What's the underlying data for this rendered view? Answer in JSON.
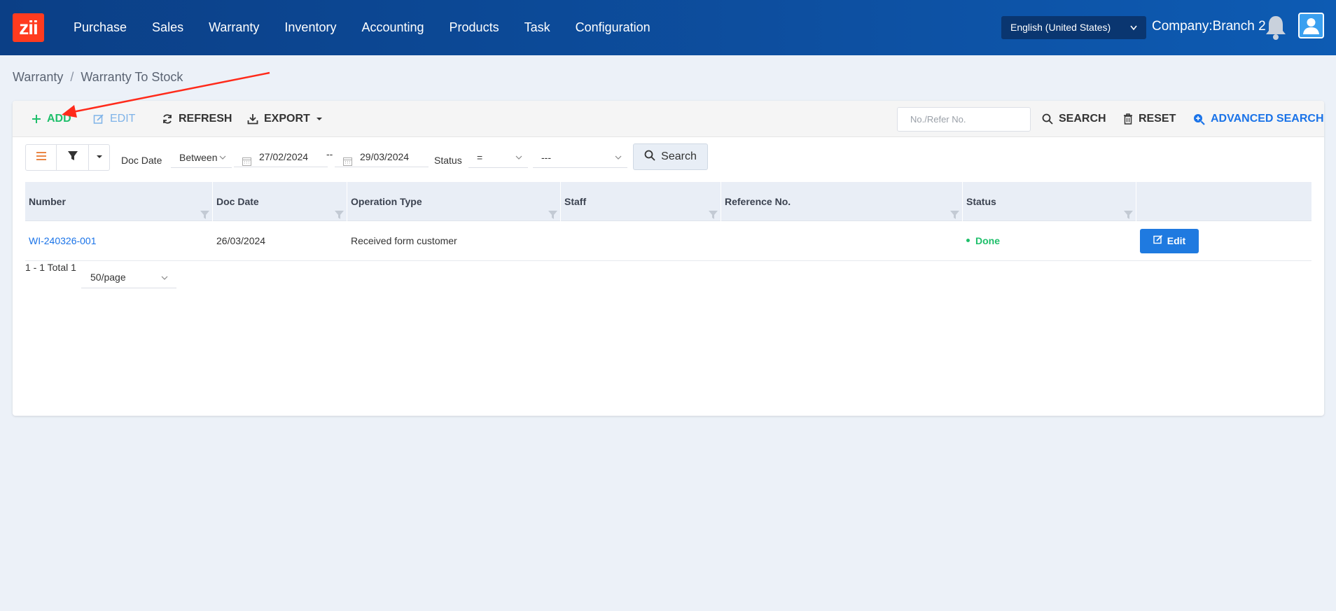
{
  "app": {
    "logo_text": "zii",
    "nav": [
      "Purchase",
      "Sales",
      "Warranty",
      "Inventory",
      "Accounting",
      "Products",
      "Task",
      "Configuration"
    ],
    "language": "English (United States)",
    "company": "Company:Branch 2"
  },
  "breadcrumb": [
    "Warranty",
    "Warranty To Stock"
  ],
  "toolbar": {
    "add": "ADD",
    "edit": "EDIT",
    "refresh": "REFRESH",
    "export": "EXPORT",
    "search_placeholder": "No./Refer No.",
    "search": "SEARCH",
    "reset": "RESET",
    "advanced_search": "ADVANCED SEARCH"
  },
  "filters": {
    "doc_date_label": "Doc Date",
    "operator": "Between",
    "date_from": "27/02/2024",
    "date_separator": "--",
    "date_to": "29/03/2024",
    "status_label": "Status",
    "status_operator": "=",
    "status_value": "---",
    "search_button": "Search"
  },
  "table": {
    "columns": [
      "Number",
      "Doc Date",
      "Operation Type",
      "Staff",
      "Reference No.",
      "Status",
      ""
    ],
    "rows": [
      {
        "number": "WI-240326-001",
        "doc_date": "26/03/2024",
        "operation_type": "Received form customer",
        "staff": "",
        "reference_no": "",
        "status": "Done",
        "action": "Edit"
      }
    ]
  },
  "pager": {
    "summary": "1 - 1 Total 1",
    "page_size": "50/page"
  },
  "colors": {
    "navbar": "#0d4fa0",
    "accent": "#1a73e8",
    "success": "#1fbf6b",
    "logo": "#ff3b1f",
    "annotation_arrow": "#ff2a1a"
  }
}
